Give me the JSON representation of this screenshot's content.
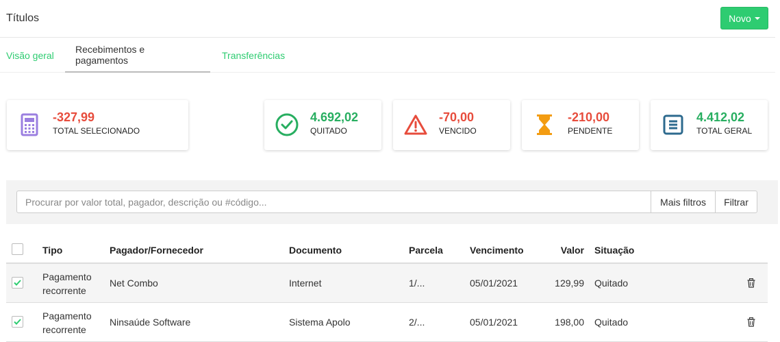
{
  "header": {
    "title": "Títulos",
    "new_button": "Novo"
  },
  "tabs": [
    {
      "label": "Visão geral"
    },
    {
      "label": "Recebimentos e pagamentos"
    },
    {
      "label": "Transferências"
    }
  ],
  "summary": [
    {
      "value": "-327,99",
      "label": "TOTAL SELECIONADO",
      "icon": "calculator-icon",
      "color": "#9b7fe0"
    },
    {
      "value": "4.692,02",
      "label": "QUITADO",
      "icon": "check-circle-icon",
      "color": "#27ae60"
    },
    {
      "value": "-70,00",
      "label": "VENCIDO",
      "icon": "warning-triangle-icon",
      "color": "#e74c3c"
    },
    {
      "value": "-210,00",
      "label": "PENDENTE",
      "icon": "hourglass-icon",
      "color": "#f39c12"
    },
    {
      "value": "4.412,02",
      "label": "TOTAL GERAL",
      "icon": "list-square-icon",
      "color": "#2d6a8e"
    }
  ],
  "search": {
    "placeholder": "Procurar por valor total, pagador, descrição ou #código...",
    "more_filters": "Mais filtros",
    "filter": "Filtrar"
  },
  "table": {
    "columns": [
      "Tipo",
      "Pagador/Fornecedor",
      "Documento",
      "Parcela",
      "Vencimento",
      "Valor",
      "Situação"
    ],
    "rows": [
      {
        "checked": true,
        "tipo_line1": "Pagamento",
        "tipo_line2": "recorrente",
        "pagador": "Net Combo",
        "documento": "Internet",
        "parcela": "1/...",
        "vencimento": "05/01/2021",
        "valor": "129,99",
        "situacao": "Quitado"
      },
      {
        "checked": true,
        "tipo_line1": "Pagamento",
        "tipo_line2": "recorrente",
        "pagador": "Ninsaúde Software",
        "documento": "Sistema Apolo",
        "parcela": "2/...",
        "vencimento": "05/01/2021",
        "valor": "198,00",
        "situacao": "Quitado"
      }
    ]
  }
}
